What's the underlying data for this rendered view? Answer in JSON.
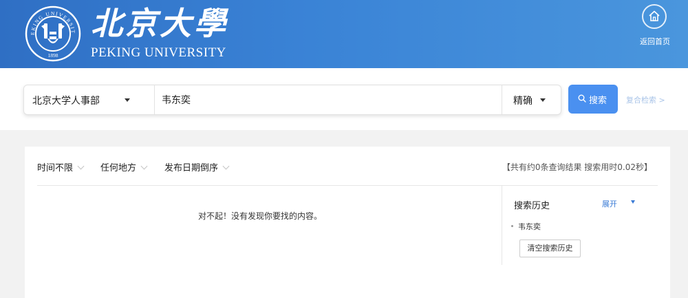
{
  "header": {
    "logo_cn": "北京大學",
    "logo_en": "PEKING UNIVERSITY",
    "seal_text": "PEKING UNIVERSITY",
    "seal_year": "1898",
    "home_label": "返回首页",
    "icons": {
      "seal": "pku-seal-logo",
      "home": "home-icon"
    }
  },
  "search": {
    "scope_value": "北京大学人事部",
    "query_value": "韦东奕",
    "mode_value": "精确",
    "button_label": "搜索",
    "advanced_link": "复合检索 >",
    "colors": {
      "button": "#4a90f0",
      "advanced_link": "#a9c4e8"
    }
  },
  "filters": {
    "time": "时间不限",
    "location": "任何地方",
    "sort": "发布日期倒序"
  },
  "results": {
    "stats": "【共有约0条查询结果 搜索用时0.02秒】",
    "empty_message": "对不起！没有发现你要找的内容。"
  },
  "history": {
    "title": "搜索历史",
    "toggle_label": "展开",
    "items": [
      "韦东奕"
    ],
    "clear_label": "清空搜索历史",
    "colors": {
      "toggle": "#3a7bd5"
    }
  },
  "colors": {
    "header_start": "#2f6fc4",
    "header_end": "#4a96dd",
    "page_bg": "#f2f2f2"
  }
}
